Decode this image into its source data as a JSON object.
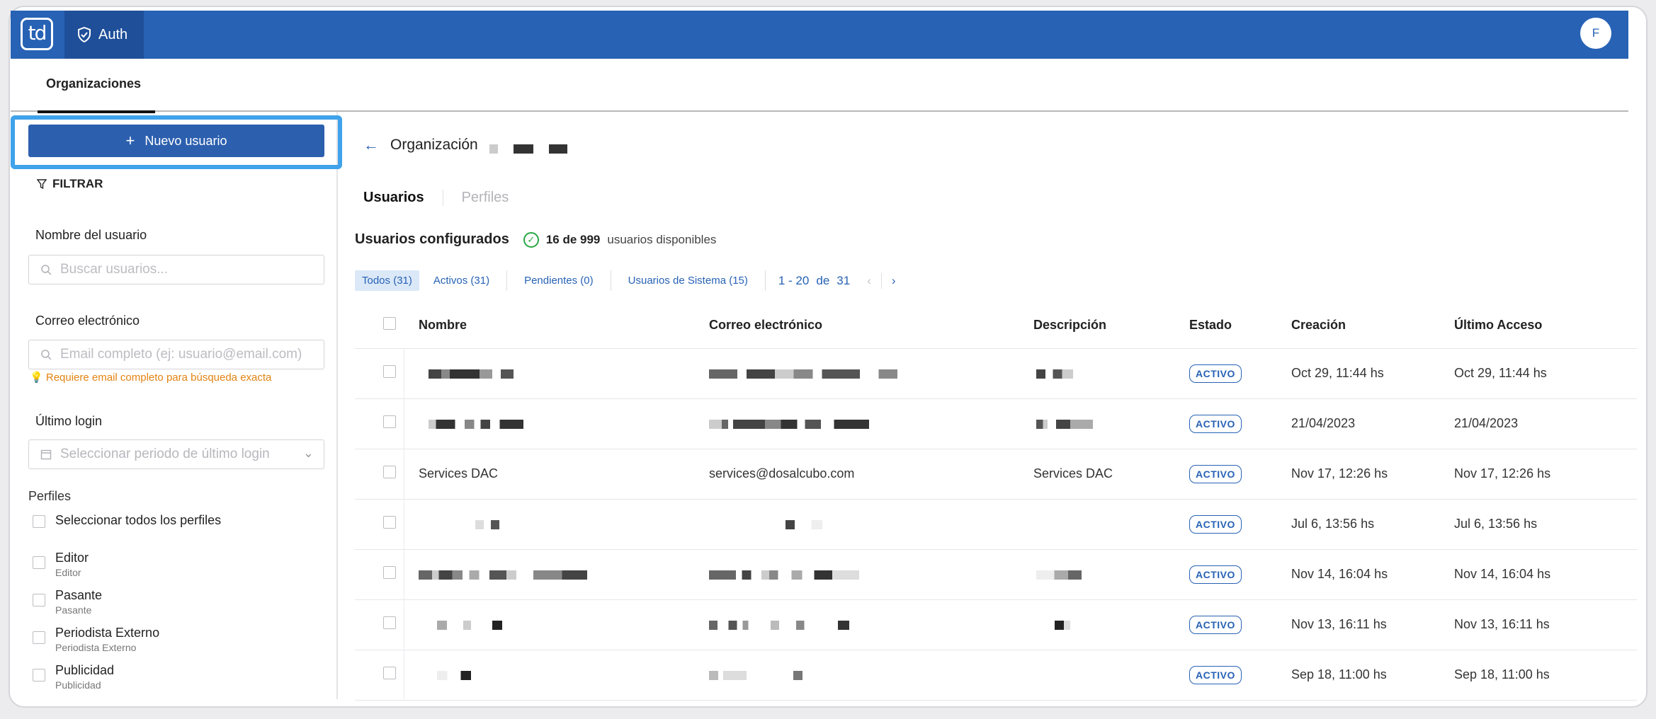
{
  "app": {
    "logo_text": "td",
    "module": "Auth",
    "avatar_initial": "F"
  },
  "subnav": {
    "tab": "Organizaciones"
  },
  "sidebar": {
    "new_user_label": "Nuevo usuario",
    "filter_title": "FILTRAR",
    "name_label": "Nombre del usuario",
    "name_placeholder": "Buscar usuarios...",
    "email_label": "Correo electrónico",
    "email_placeholder": "Email completo (ej: usuario@email.com)",
    "email_hint": "Requiere email completo para búsqueda exacta",
    "login_label": "Último login",
    "login_placeholder": "Seleccionar periodo de último login",
    "profiles_title": "Perfiles",
    "select_all_label": "Seleccionar todos los perfiles",
    "profiles": [
      {
        "name": "Editor",
        "sub": "Editor"
      },
      {
        "name": "Pasante",
        "sub": "Pasante"
      },
      {
        "name": "Periodista Externo",
        "sub": "Periodista Externo"
      },
      {
        "name": "Publicidad",
        "sub": "Publicidad"
      }
    ]
  },
  "main": {
    "org_label": "Organización",
    "tabs": [
      "Usuarios",
      "Perfiles"
    ],
    "section_title": "Usuarios configurados",
    "available_count": "16 de 999",
    "available_text": "usuarios disponibles",
    "filters": [
      "Todos (31)",
      "Activos (31)",
      "Pendientes (0)",
      "Usuarios de Sistema (15)"
    ],
    "pager": {
      "range": "1 - 20",
      "of": "de",
      "total": "31"
    },
    "columns": [
      "Nombre",
      "Correo electrónico",
      "Descripción",
      "Estado",
      "Creación",
      "Último Acceso"
    ],
    "rows": [
      {
        "name": "",
        "email": "",
        "desc": "",
        "status": "ACTIVO",
        "created": "Oct 29, 11:44 hs",
        "last": "Oct 29, 11:44 hs"
      },
      {
        "name": "",
        "email": "",
        "desc": "",
        "status": "ACTIVO",
        "created": "21/04/2023",
        "last": "21/04/2023"
      },
      {
        "name": "Services DAC",
        "email": "services@dosalcubo.com",
        "desc": "Services DAC",
        "status": "ACTIVO",
        "created": "Nov 17, 12:26 hs",
        "last": "Nov 17, 12:26 hs"
      },
      {
        "name": "",
        "email": "",
        "desc": "",
        "status": "ACTIVO",
        "created": "Jul 6, 13:56 hs",
        "last": "Jul 6, 13:56 hs"
      },
      {
        "name": "",
        "email": "",
        "desc": "",
        "status": "ACTIVO",
        "created": "Nov 14, 16:04 hs",
        "last": "Nov 14, 16:04 hs"
      },
      {
        "name": "",
        "email": "",
        "desc": "",
        "status": "ACTIVO",
        "created": "Nov 13, 16:11 hs",
        "last": "Nov 13, 16:11 hs"
      },
      {
        "name": "",
        "email": "",
        "desc": "",
        "status": "ACTIVO",
        "created": "Sep 18, 11:00 hs",
        "last": "Sep 18, 11:00 hs"
      }
    ]
  },
  "colors": {
    "brand": "#2762b5",
    "brand_dark": "#1f4f99",
    "highlight": "#3fa2ea",
    "success": "#28a745",
    "hint": "#e38312"
  }
}
